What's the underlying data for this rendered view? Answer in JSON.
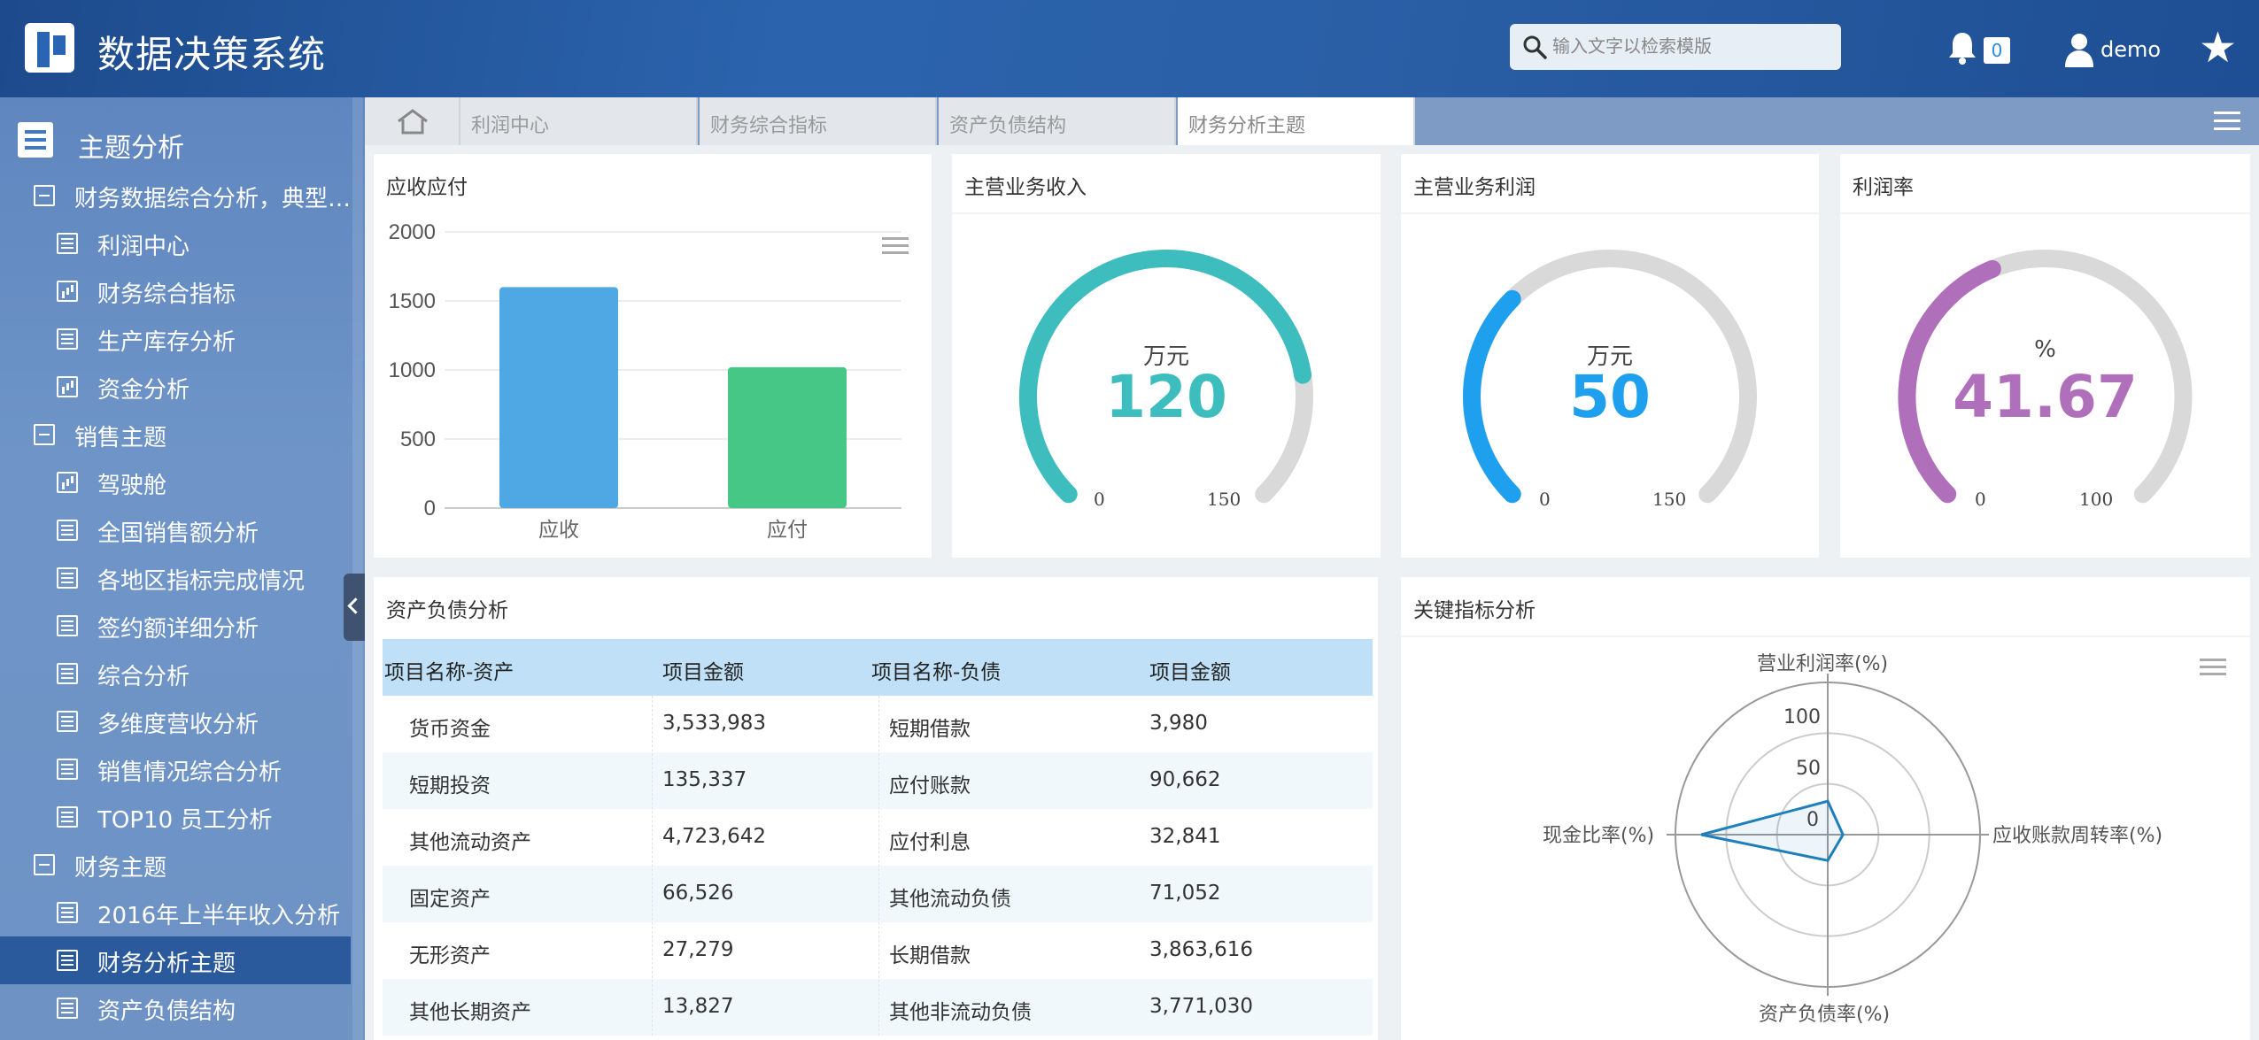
{
  "header": {
    "app_title": "数据决策系统",
    "search_placeholder": "输入文字以检索模版",
    "notification_count": "0",
    "username": "demo"
  },
  "sidebar": {
    "title": "主题分析",
    "items": [
      {
        "label": "财务数据综合分析，典型钻...",
        "type": "group",
        "icon": "minus-box-icon"
      },
      {
        "label": "利润中心",
        "type": "leaf",
        "icon": "table-report-icon"
      },
      {
        "label": "财务综合指标",
        "type": "leaf",
        "icon": "bar-report-icon"
      },
      {
        "label": "生产库存分析",
        "type": "leaf",
        "icon": "table-report-icon"
      },
      {
        "label": "资金分析",
        "type": "leaf",
        "icon": "bar-report-icon"
      },
      {
        "label": "销售主题",
        "type": "group",
        "icon": "minus-box-icon"
      },
      {
        "label": "驾驶舱",
        "type": "leaf",
        "icon": "bar-report-icon"
      },
      {
        "label": "全国销售额分析",
        "type": "leaf",
        "icon": "table-report-icon"
      },
      {
        "label": "各地区指标完成情况",
        "type": "leaf",
        "icon": "table-report-icon"
      },
      {
        "label": "签约额详细分析",
        "type": "leaf",
        "icon": "table-report-icon"
      },
      {
        "label": "综合分析",
        "type": "leaf",
        "icon": "table-report-icon"
      },
      {
        "label": "多维度营收分析",
        "type": "leaf",
        "icon": "table-report-icon"
      },
      {
        "label": "销售情况综合分析",
        "type": "leaf",
        "icon": "table-report-icon"
      },
      {
        "label": "TOP10 员工分析",
        "type": "leaf",
        "icon": "table-report-icon"
      },
      {
        "label": "财务主题",
        "type": "group",
        "icon": "minus-box-icon"
      },
      {
        "label": "2016年上半年收入分析",
        "type": "leaf",
        "icon": "table-report-icon"
      },
      {
        "label": "财务分析主题",
        "type": "leaf",
        "icon": "table-report-icon",
        "active": true
      },
      {
        "label": "资产负债结构",
        "type": "leaf",
        "icon": "table-report-icon"
      }
    ]
  },
  "tabs": [
    {
      "label": "利润中心"
    },
    {
      "label": "财务综合指标"
    },
    {
      "label": "资产负债结构"
    },
    {
      "label": "财务分析主题",
      "active": true
    }
  ],
  "panels": {
    "receivable": {
      "title": "应收应付"
    },
    "revenue": {
      "title": "主营业务收入",
      "unit": "万元",
      "value": "120",
      "min": "0",
      "max": "150",
      "fraction": 0.8,
      "color": "#3dbdbd"
    },
    "profit": {
      "title": "主营业务利润",
      "unit": "万元",
      "value": "50",
      "min": "0",
      "max": "150",
      "fraction": 0.3333,
      "color": "#1ea0ee"
    },
    "margin": {
      "title": "利润率",
      "unit": "%",
      "value": "41.67",
      "min": "0",
      "max": "100",
      "fraction": 0.4167,
      "color": "#b06fba"
    },
    "balance": {
      "title": "资产负债分析",
      "headers": [
        "项目名称-资产",
        "项目金额",
        "项目名称-负债",
        "项目金额"
      ],
      "rows": [
        [
          "货币资金",
          "3,533,983",
          "短期借款",
          "3,980"
        ],
        [
          "短期投资",
          "135,337",
          "应付账款",
          "90,662"
        ],
        [
          "其他流动资产",
          "4,723,642",
          "应付利息",
          "32,841"
        ],
        [
          "固定资产",
          "66,526",
          "其他流动负债",
          "71,052"
        ],
        [
          "无形资产",
          "27,279",
          "长期借款",
          "3,863,616"
        ],
        [
          "其他长期资产",
          "13,827",
          "其他非流动负债",
          "3,771,030"
        ]
      ]
    },
    "kpi": {
      "title": "关键指标分析"
    }
  },
  "chart_data": [
    {
      "type": "bar",
      "categories": [
        "应收",
        "应付"
      ],
      "values": [
        1600,
        1020
      ],
      "colors": [
        "#4fa8e4",
        "#47c786"
      ],
      "yticks": [
        "2000",
        "1500",
        "1000",
        "500",
        "0"
      ],
      "ylim": [
        0,
        2000
      ],
      "grid": true
    },
    {
      "type": "radar",
      "indicators": [
        "营业利润率(%)",
        "应收账款周转率(%)",
        "资产负债率(%)",
        "现金比率(%)"
      ],
      "values": [
        22,
        10,
        17,
        83
      ],
      "rlim": [
        0,
        100
      ],
      "ticks": [
        "100",
        "50",
        "0"
      ],
      "color": "#1f7fbd"
    }
  ]
}
